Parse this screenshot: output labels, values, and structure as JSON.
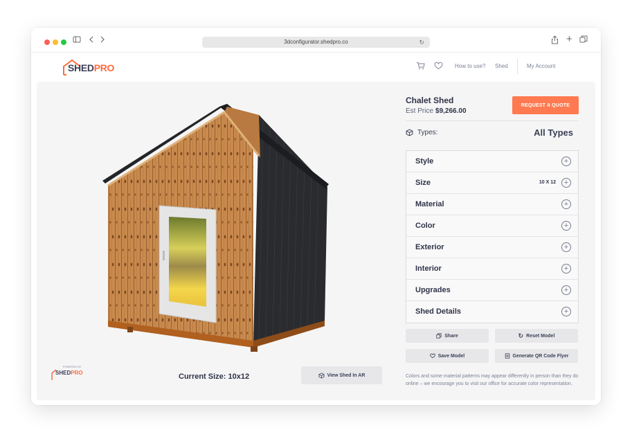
{
  "browser": {
    "url": "3dconfigurator.shedpro.co",
    "icons": [
      "sidebar-icon",
      "back-icon",
      "forward-icon",
      "reload-icon",
      "share-icon",
      "new-tab-icon",
      "tabs-icon"
    ]
  },
  "header": {
    "logo_main": "SHED",
    "logo_accent": "PRO",
    "nav": {
      "how_to_use": "How to use?",
      "shed": "Shed",
      "account": "My Account"
    },
    "icons": [
      "cart-icon",
      "heart-icon"
    ]
  },
  "product": {
    "name": "Chalet Shed",
    "est_price_label": "Est Price",
    "est_price_value": "$9,266.00",
    "quote_button": "REQUEST A QUOTE",
    "types_label": "Types:",
    "types_value": "All Types"
  },
  "accordion": [
    {
      "label": "Style",
      "value": ""
    },
    {
      "label": "Size",
      "value": "10 X 12"
    },
    {
      "label": "Material",
      "value": ""
    },
    {
      "label": "Color",
      "value": ""
    },
    {
      "label": "Exterior",
      "value": ""
    },
    {
      "label": "Interior",
      "value": ""
    },
    {
      "label": "Upgrades",
      "value": ""
    },
    {
      "label": "Shed Details",
      "value": ""
    }
  ],
  "actions": {
    "share": "Share",
    "reset": "Reset Model",
    "save": "Save Model",
    "qr": "Generate QR Code Flyer"
  },
  "viewer": {
    "powered_by": "POWERED BY",
    "current_size": "Current Size: 10x12",
    "ar_button": "View Shed In AR"
  },
  "disclaimer": "Colors and some material patterns may appear differently in person than they do online – we encourage you to visit our office for accurate color representation.",
  "colors": {
    "accent": "#ff7a50",
    "brand_dark": "#3a3f55",
    "wood": "#c9874a",
    "siding": "#2a2b2e"
  }
}
